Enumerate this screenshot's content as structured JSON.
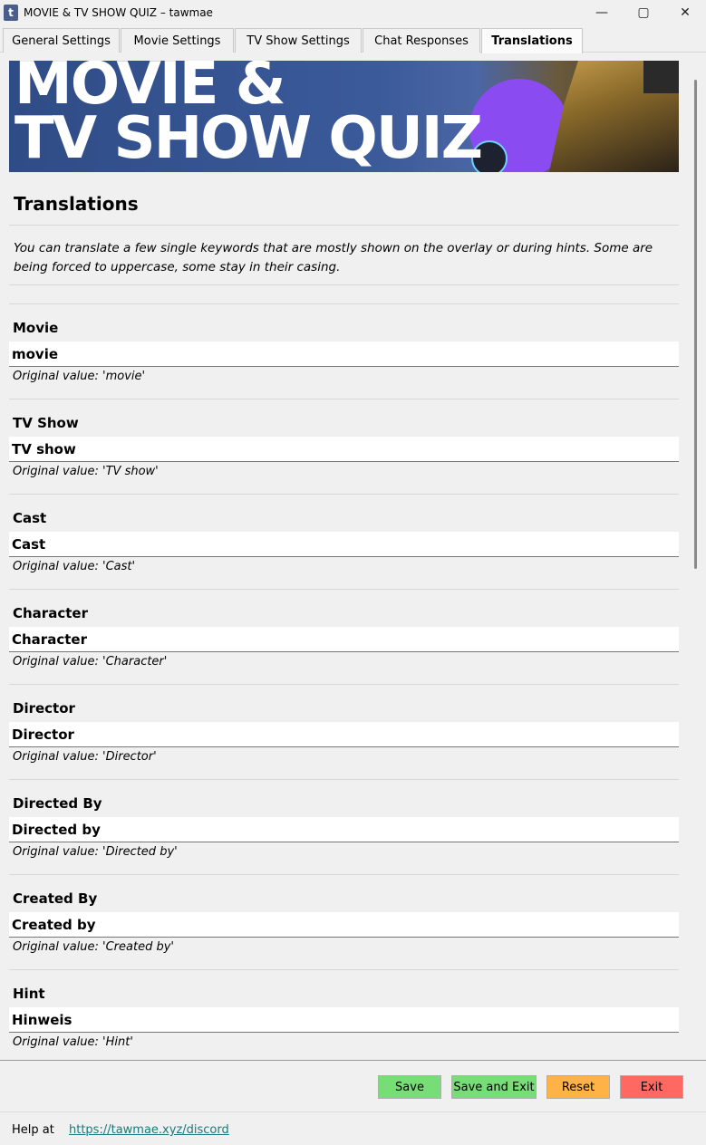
{
  "window": {
    "app_icon": "t",
    "title": "MOVIE & TV SHOW QUIZ – tawmae",
    "minimize_glyph": "—",
    "maximize_glyph": "▢",
    "close_glyph": "✕"
  },
  "tabs": [
    {
      "label": "General Settings"
    },
    {
      "label": "Movie Settings"
    },
    {
      "label": "TV Show Settings"
    },
    {
      "label": "Chat Responses"
    },
    {
      "label": "Translations",
      "active": true
    }
  ],
  "banner": {
    "line1": "MOVIE &",
    "line2": "TV SHOW QUIZ"
  },
  "page": {
    "title": "Translations",
    "description": "You can translate a few single keywords that are mostly shown on the overlay or during hints. Some are being forced to uppercase, some stay in their casing."
  },
  "items": [
    {
      "label": "Movie",
      "value": "movie",
      "original": "Original value: 'movie'"
    },
    {
      "label": "TV Show",
      "value": "TV show",
      "original": "Original value: 'TV show'"
    },
    {
      "label": "Cast",
      "value": "Cast",
      "original": "Original value: 'Cast'"
    },
    {
      "label": "Character",
      "value": "Character",
      "original": "Original value: 'Character'"
    },
    {
      "label": "Director",
      "value": "Director",
      "original": "Original value: 'Director'"
    },
    {
      "label": "Directed By",
      "value": "Directed by",
      "original": "Original value: 'Directed by'"
    },
    {
      "label": "Created By",
      "value": "Created by",
      "original": "Original value: 'Created by'"
    },
    {
      "label": "Hint",
      "value": "Hinweis",
      "original": "Original value: 'Hint'"
    }
  ],
  "buttons": {
    "save": "Save",
    "save_exit": "Save and Exit",
    "reset": "Reset",
    "exit": "Exit"
  },
  "colors": {
    "save": "#77dd77",
    "save_exit": "#77dd77",
    "reset": "#ffb347",
    "exit": "#ff6961",
    "link": "#1a7a7a"
  },
  "footer": {
    "help_text": "Help at",
    "help_link": "https://tawmae.xyz/discord"
  }
}
